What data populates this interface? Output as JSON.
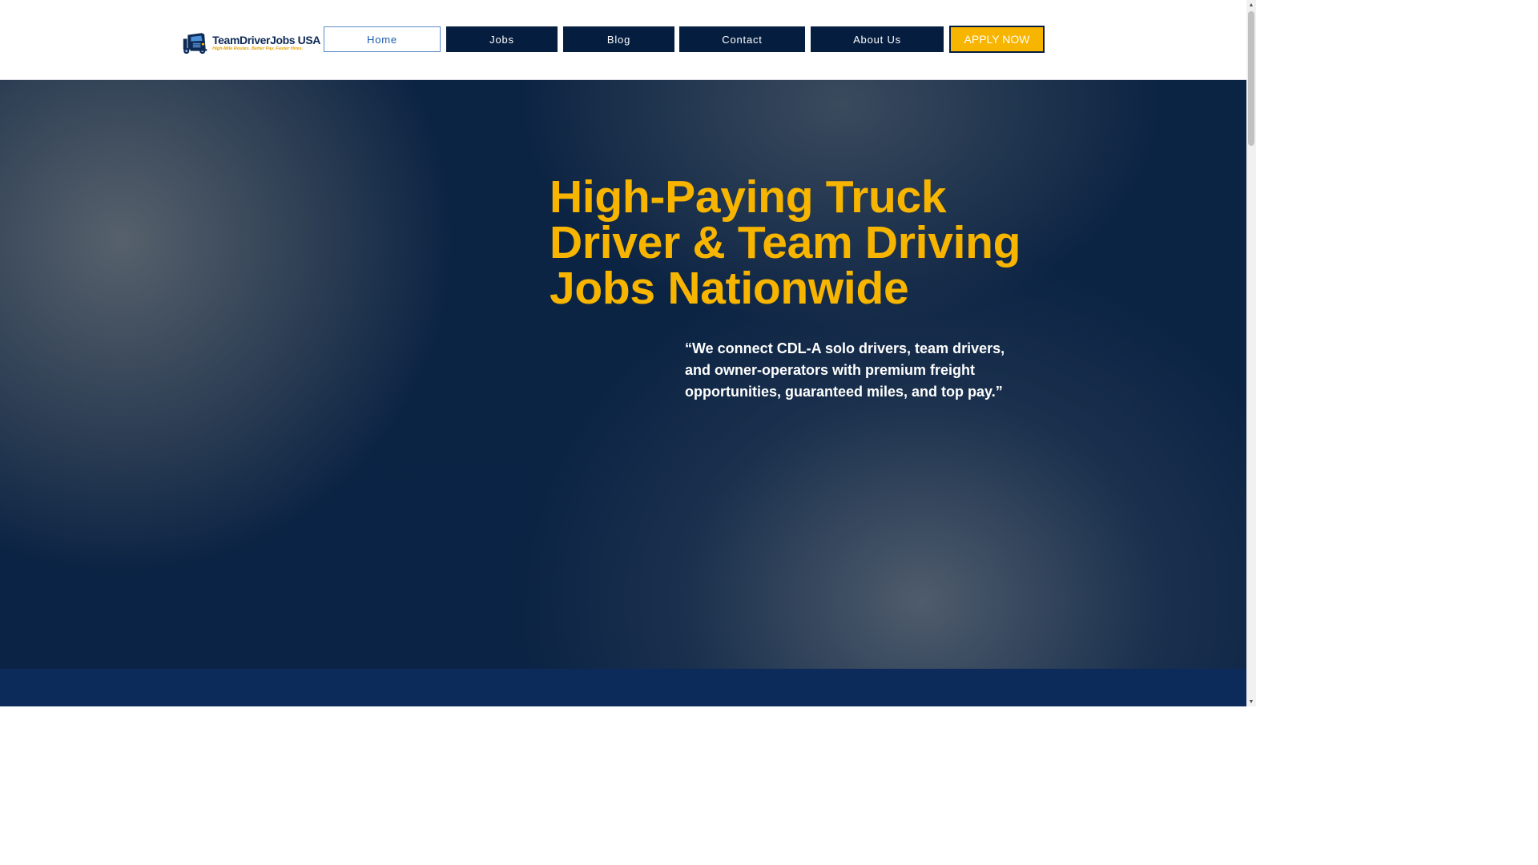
{
  "header": {
    "logo": {
      "icon": "truck-icon",
      "name": "TeamDriverJobs USA",
      "tagline": "High-Mile Routes. Better Pay. Faster Hires."
    },
    "nav": [
      {
        "label": "Home",
        "active": true
      },
      {
        "label": "Jobs",
        "active": false
      },
      {
        "label": "Blog",
        "active": false
      },
      {
        "label": "Contact",
        "active": false
      },
      {
        "label": "About Us",
        "active": false
      }
    ],
    "apply_label": "APPLY NOW"
  },
  "hero": {
    "title": "High-Paying Truck Driver & Team Driving Jobs Nationwide",
    "quote": "“We connect CDL-A solo drivers, team drivers, and owner-operators with premium freight opportunities, guaranteed miles, and top pay.”"
  },
  "colors": {
    "navy": "#051d3f",
    "accent_yellow": "#f7b500",
    "active_link": "#1a5bb0"
  },
  "scrollbar": {
    "up_icon": "scroll-up-arrow-icon",
    "down_icon": "scroll-down-arrow-icon"
  }
}
